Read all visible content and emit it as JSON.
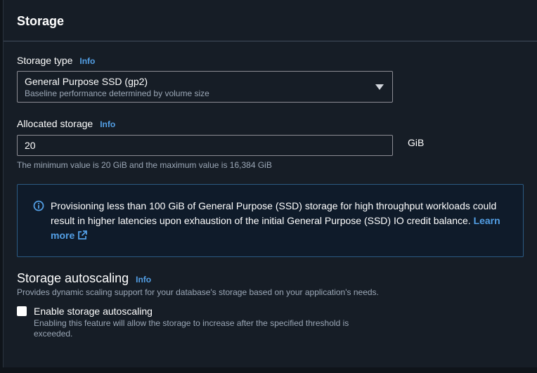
{
  "panel": {
    "title": "Storage"
  },
  "storage_type": {
    "label": "Storage type",
    "info": "Info",
    "selected_value": "General Purpose SSD (gp2)",
    "selected_description": "Baseline performance determined by volume size"
  },
  "allocated_storage": {
    "label": "Allocated storage",
    "info": "Info",
    "value": "20",
    "unit": "GiB",
    "constraint": "The minimum value is 20 GiB and the maximum value is 16,384 GiB"
  },
  "alert": {
    "text": "Provisioning less than 100 GiB of General Purpose (SSD) storage for high throughput workloads could result in higher latencies upon exhaustion of the initial General Purpose (SSD) IO credit balance.",
    "link_text": "Learn more"
  },
  "autoscaling": {
    "heading": "Storage autoscaling",
    "info": "Info",
    "description": "Provides dynamic scaling support for your database's storage based on your application's needs.",
    "checkbox_label": "Enable storage autoscaling",
    "checkbox_description": "Enabling this feature will allow the storage to increase after the specified threshold is exceeded.",
    "checked": false
  },
  "colors": {
    "accent_link": "#539fe5",
    "panel_bg": "#161d26",
    "alert_border": "#2c5a82"
  }
}
